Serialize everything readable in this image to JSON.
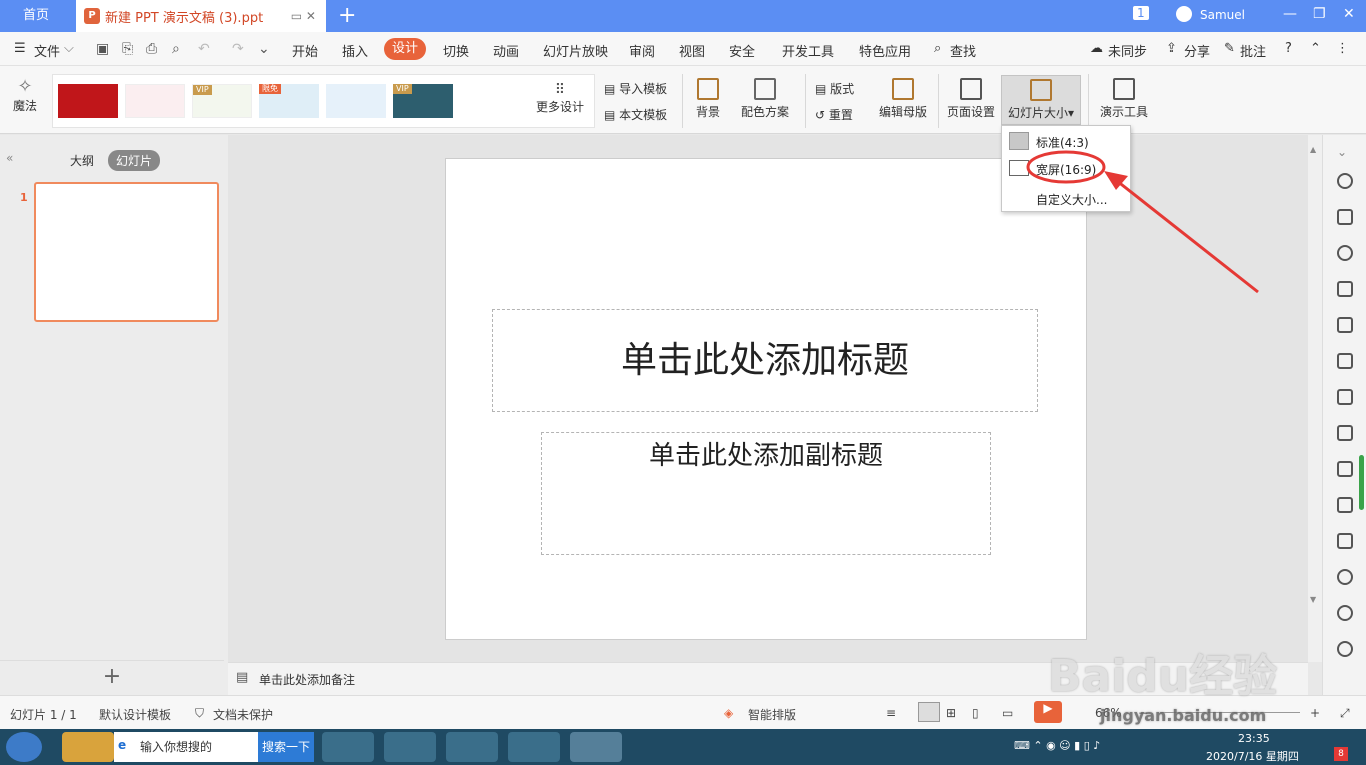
{
  "titlebar": {
    "home_tab": "首页",
    "doc_tab": "新建 PPT 演示文稿 (3).ppt",
    "badge": "1",
    "user": "Samuel",
    "logo_letter": "P"
  },
  "menu": {
    "file": "文件",
    "items": [
      "开始",
      "插入",
      "设计",
      "切换",
      "动画",
      "幻灯片放映",
      "审阅",
      "视图",
      "安全",
      "开发工具",
      "特色应用"
    ],
    "active": "设计",
    "search": "查找",
    "sync": "未同步",
    "share": "分享",
    "comment": "批注",
    "help": "?"
  },
  "ribbon": {
    "magic": "魔法",
    "more_design": "更多设计",
    "vip": "VIP",
    "limited": "限免",
    "import_tpl": "导入模板",
    "this_tpl": "本文模板",
    "background": "背景",
    "color_scheme": "配色方案",
    "layout": "版式",
    "reset": "重置",
    "edit_master": "编辑母版",
    "page_setup": "页面设置",
    "slide_size": "幻灯片大小",
    "present_tools": "演示工具"
  },
  "dropdown": {
    "standard": "标准(4:3)",
    "widescreen": "宽屏(16:9)",
    "custom": "自定义大小..."
  },
  "leftpanel": {
    "outline_tab": "大纲",
    "slides_tab": "幻灯片",
    "slide_num": "1",
    "add": "+"
  },
  "slide": {
    "title": "单击此处添加标题",
    "subtitle": "单击此处添加副标题"
  },
  "notes": {
    "placeholder": "单击此处添加备注"
  },
  "status": {
    "slide_count": "幻灯片 1 / 1",
    "template": "默认设计模板",
    "protect": "文档未保护",
    "smart": "智能排版",
    "zoom": "66%"
  },
  "taskbar": {
    "search_placeholder": "输入你想搜的",
    "search_button": "搜索一下",
    "time": "23:35",
    "date": "2020/7/16 星期四",
    "notif": "8"
  },
  "watermark": {
    "brand": "Baidu经验",
    "url": "jingyan.baidu.com"
  },
  "colors": {
    "accent": "#e8633a",
    "titlebar": "#5b8ef3",
    "annotation": "#e53935"
  }
}
